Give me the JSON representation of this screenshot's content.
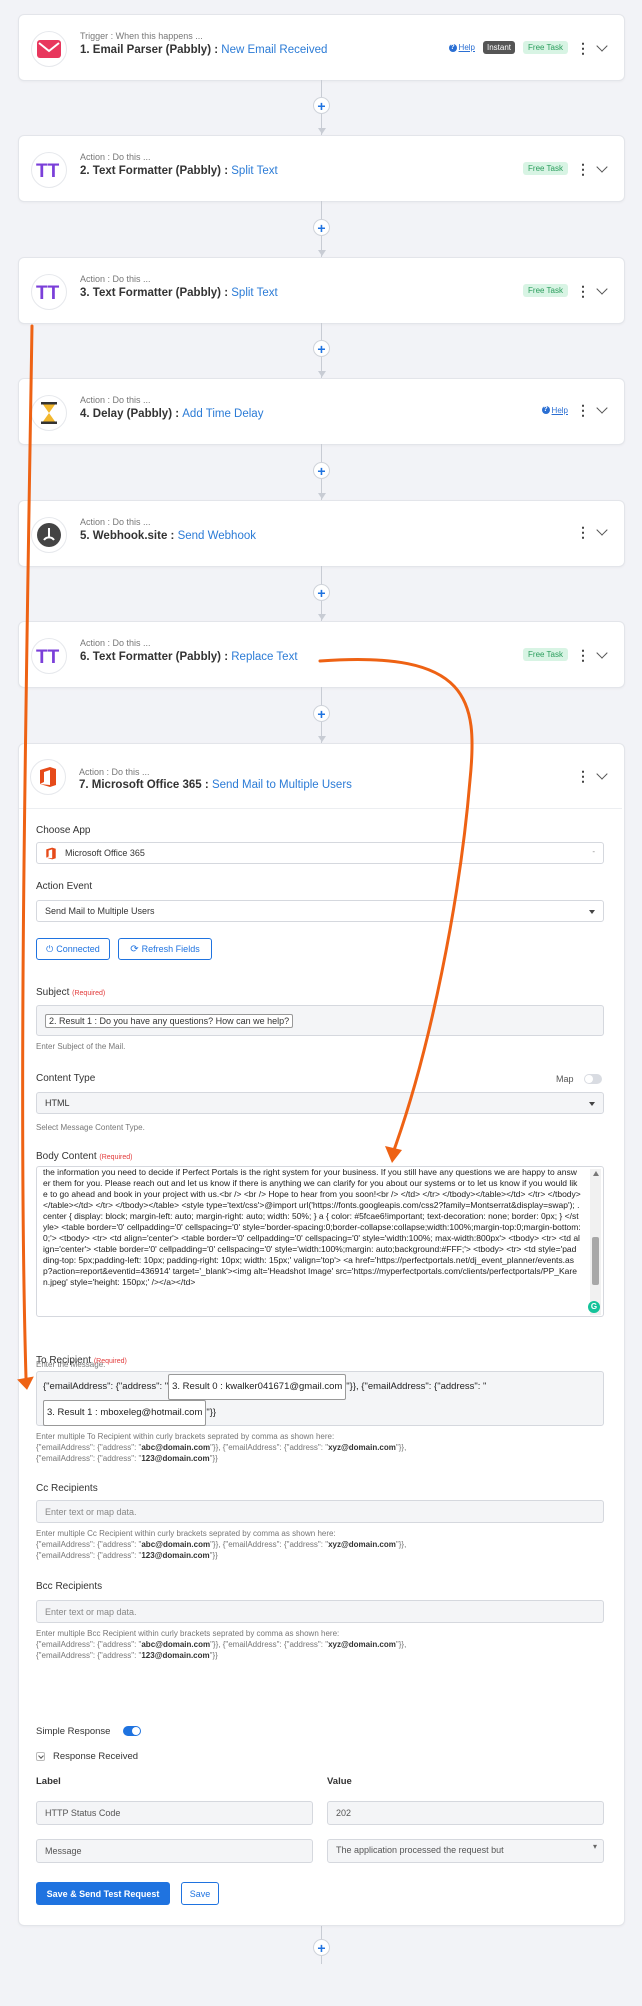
{
  "steps": [
    {
      "pre": "Trigger : When this happens ...",
      "title": "1. Email Parser (Pabbly) :",
      "event": "New Email Received",
      "help": "Help",
      "instant": "Instant",
      "free": "Free Task"
    },
    {
      "pre": "Action : Do this ...",
      "title": "2. Text Formatter (Pabbly) :",
      "event": "Split Text",
      "free": "Free Task"
    },
    {
      "pre": "Action : Do this ...",
      "title": "3. Text Formatter (Pabbly) :",
      "event": "Split Text",
      "free": "Free Task"
    },
    {
      "pre": "Action : Do this ...",
      "title": "4. Delay (Pabbly) :",
      "event": "Add Time Delay",
      "help": "Help"
    },
    {
      "pre": "Action : Do this ...",
      "title": "5. Webhook.site :",
      "event": "Send Webhook"
    },
    {
      "pre": "Action : Do this ...",
      "title": "6. Text Formatter (Pabbly) :",
      "event": "Replace Text",
      "free": "Free Task"
    },
    {
      "pre": "Action : Do this ...",
      "title": "7. Microsoft Office 365 :",
      "event": "Send Mail to Multiple Users"
    }
  ],
  "form": {
    "choose_app_label": "Choose App",
    "choose_app_value": "Microsoft Office 365",
    "action_event_label": "Action Event",
    "action_event_value": "Send Mail to Multiple Users",
    "connected_btn": "Connected",
    "refresh_btn": "Refresh Fields",
    "subject_label": "Subject",
    "required": "(Required)",
    "subject_value": "2. Result 1 : Do you have any questions? How can we help?",
    "subject_hint": "Enter Subject of the Mail.",
    "content_type_label": "Content Type",
    "map_label": "Map",
    "content_type_value": "HTML",
    "content_type_hint": "Select Message Content Type.",
    "body_label": "Body Content",
    "body_text": "the information you need to decide if Perfect Portals is the right system for your business. If you still have any questions we are happy to answer them for you. Please reach out and let us know if there is anything we can clarify for you about our systems or to let us know if you would like to go ahead and book in your project with us.<br /> <br /> Hope to hear from you soon!<br /> </td> </tr> </tbody></table></td> </tr> </tbody></table></td> </tr> </tbody></table> <style type='text/css'>@import url('https://fonts.googleapis.com/css2?family=Montserrat&display=swap'); .center { display: block; margin-left: auto; margin-right: auto; width: 50%; } a { color: #5fcae6!important; text-decoration: none; border: 0px; } </style> <table border='0' cellpadding='0' cellspacing='0' style='border-spacing:0;border-collapse:collapse;width:100%;margin-top:0;margin-bottom:0;'> <tbody> <tr> <td align='center'> <table border='0' cellpadding='0' cellspacing='0' style='width:100%; max-width:800px'> <tbody> <tr> <td align='center'> <table border='0' cellpadding='0' cellspacing='0' style='width:100%;margin: auto;background:#FFF;'> <tbody> <tr> <td style='padding-top: 5px;padding-left: 10px; padding-right: 10px; width: 15px;' valign='top'> <a href='https://perfectportals.net/dj_event_planner/events.asp?action=report&eventid=436914' target='_blank'><img alt='Headshot Image' src='https://myperfectportals.com/clients/perfectportals/PP_Karen.jpeg' style='height: 150px;' /></a></td>",
    "body_hint": "Enter the Message.",
    "to_label": "To Recipient",
    "to_line1_pre": "{\"emailAddress\": {\"address\": \"",
    "to_pill1": "3. Result 0 : kwalker041671@gmail.com",
    "to_line1_mid": "\"}}, {\"emailAddress\": {\"address\": \"",
    "to_pill2": "3. Result 1 : mboxeleg@hotmail.com",
    "to_line2_post": "\"}}",
    "recip_hint_to": "Enter multiple To Recipient within curly brackets seprated by comma as shown here:",
    "recip_hint_cc": "Enter multiple Cc Recipient within curly brackets seprated by comma as shown here:",
    "recip_hint_bcc": "Enter multiple Bcc Recipient within curly brackets seprated by comma as shown here:",
    "ex_a": "{\"emailAddress\": {\"address\": \"",
    "ex_abc": "abc@domain.com",
    "ex_mid": "\"}}, {\"emailAddress\": {\"address\": \"",
    "ex_xyz": "xyz@domain.com",
    "ex_end": "\"}},",
    "ex_123": "123@domain.com",
    "ex_end2": "\"}}",
    "cc_label": "Cc Recipients",
    "bcc_label": "Bcc Recipients",
    "placeholder": "Enter text or map data.",
    "simple_response": "Simple Response",
    "response_received": "Response Received",
    "col_label": "Label",
    "col_value": "Value",
    "row1_label": "HTTP Status Code",
    "row1_value": "202",
    "row2_label": "Message",
    "row2_value": "The application processed the request but",
    "save_send": "Save & Send Test Request",
    "save": "Save"
  },
  "colors": {
    "accent": "#1f73e0",
    "arrow": "#ee6214",
    "free_bg": "#d8f4e4"
  }
}
